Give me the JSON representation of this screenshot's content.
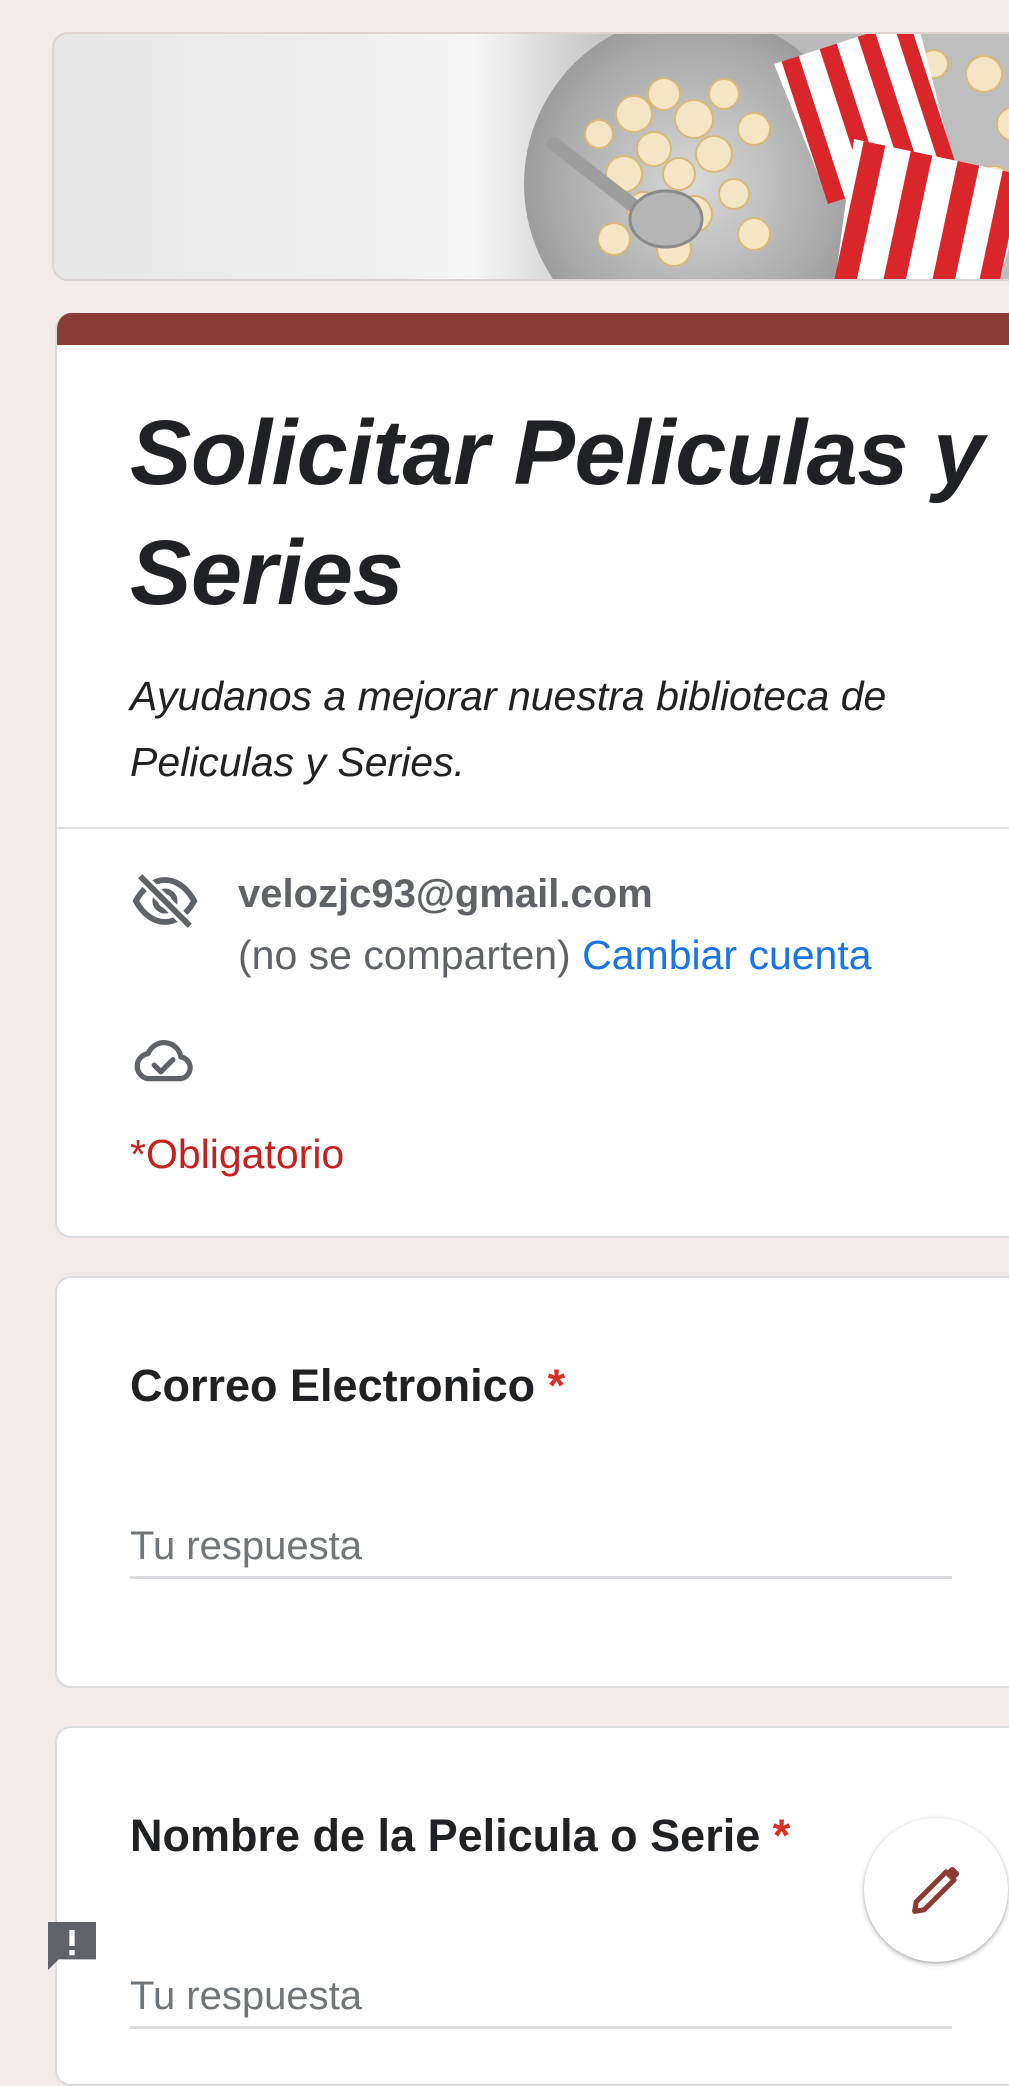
{
  "header": {
    "banner_alt": "popcorn banner"
  },
  "form": {
    "title": "Solicitar Peliculas y Series",
    "description": "Ayudanos a mejorar nuestra biblioteca de Peliculas y Series."
  },
  "account": {
    "email": "velozjc93@gmail.com",
    "sharing_note": "(no se comparten)",
    "switch_label": "Cambiar cuenta",
    "privacy_icon": "eye-off-icon",
    "saved_icon": "cloud-done-icon"
  },
  "required_note": "*Obligatorio",
  "questions": [
    {
      "title": "Correo Electronico",
      "required_mark": "*",
      "placeholder": "Tu respuesta"
    },
    {
      "title": "Nombre de la Pelicula o Serie",
      "required_mark": "*",
      "placeholder": "Tu respuesta"
    }
  ],
  "floating": {
    "edit_icon": "pencil-icon",
    "report_icon": "report-icon"
  },
  "colors": {
    "accent": "#8a3b34",
    "background": "#f3ebea",
    "link": "#1a73e8",
    "required": "#d93025"
  }
}
